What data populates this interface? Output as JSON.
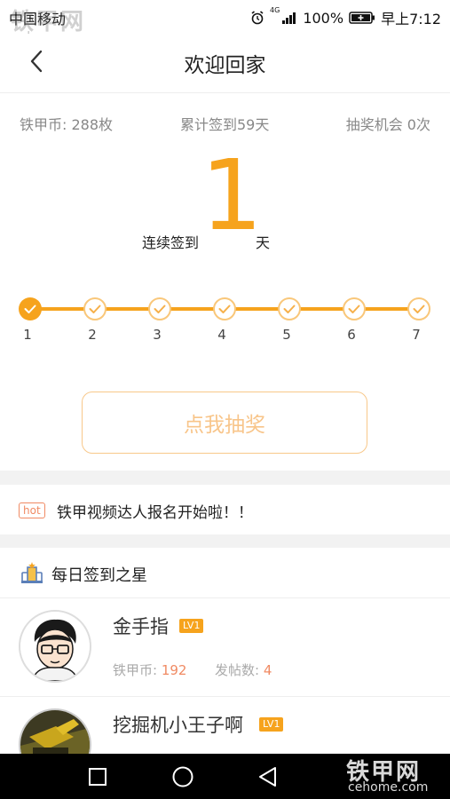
{
  "status_bar": {
    "carrier": "中国移动",
    "network": "4G",
    "battery": "100%",
    "time": "早上7:12"
  },
  "watermark": {
    "top_text": "铁甲网",
    "top_url": "cehome.com",
    "bottom_text": "铁甲网",
    "bottom_url": "cehome.com"
  },
  "nav": {
    "title": "欢迎回家"
  },
  "stats": {
    "coins": "铁甲币: 288枚",
    "total_checkins": "累计签到59天",
    "lottery_chances": "抽奖机会 0次"
  },
  "streak": {
    "label": "连续签到",
    "days": "1",
    "unit": "天"
  },
  "progress": {
    "current_day": 1,
    "days": [
      "1",
      "2",
      "3",
      "4",
      "5",
      "6",
      "7"
    ]
  },
  "draw_button": {
    "label": "点我抽奖"
  },
  "hot_banner": {
    "tag": "hot",
    "text": "铁甲视频达人报名开始啦！！"
  },
  "daily_stars": {
    "title": "每日签到之星",
    "users": [
      {
        "name": "金手指",
        "level": "LV1",
        "coins_label": "铁甲币:",
        "coins": "192",
        "posts_label": "发帖数:",
        "posts": "4"
      },
      {
        "name": "挖掘机小王子啊",
        "level": "LV1"
      }
    ]
  },
  "colors": {
    "accent": "#f6a31d",
    "accent_light": "#f8c58a",
    "hot": "#f08a63"
  }
}
